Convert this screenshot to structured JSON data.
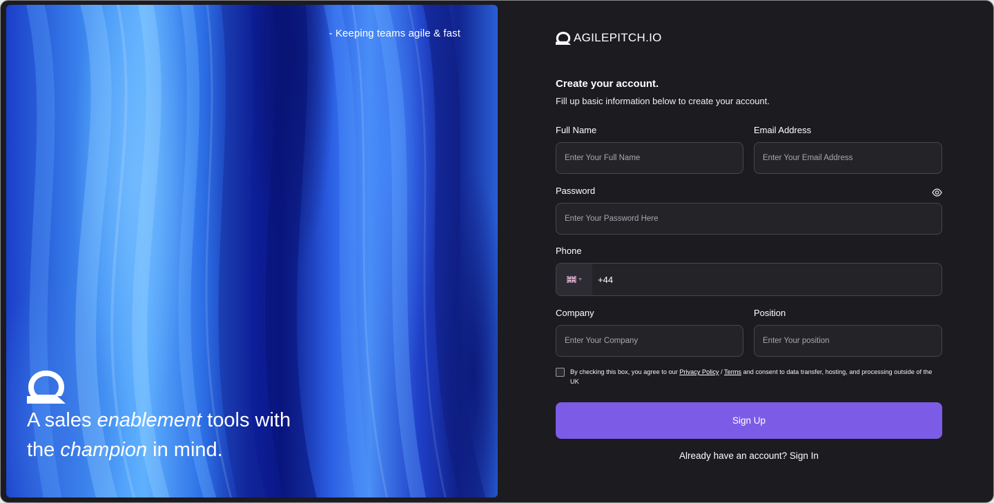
{
  "hero": {
    "quote": "- Keeping teams agile & fast",
    "tagline": {
      "part1": "A sales ",
      "em1": "enablement",
      "part2": " tools with",
      "part3": "the ",
      "em2": "champion",
      "part4": " in mind."
    }
  },
  "brand": {
    "name": "AGILEPITCH.IO"
  },
  "form": {
    "title": "Create your account.",
    "subtitle": "Fill up basic information below to create your account.",
    "full_name": {
      "label": "Full Name",
      "placeholder": "Enter Your Full Name",
      "value": ""
    },
    "email": {
      "label": "Email Address",
      "placeholder": "Enter Your Email Address",
      "value": ""
    },
    "password": {
      "label": "Password",
      "placeholder": "Enter Your Password Here",
      "value": ""
    },
    "phone": {
      "label": "Phone",
      "country": "UK",
      "code": "+44"
    },
    "company": {
      "label": "Company",
      "placeholder": "Enter Your Company",
      "value": ""
    },
    "position": {
      "label": "Position",
      "placeholder": "Enter Your position",
      "value": ""
    },
    "consent": {
      "before": "By checking this box, you agree to our ",
      "privacy": "Privacy Policy",
      "sep": " / ",
      "terms": "Terms",
      "after": " and consent to data transfer, hosting, and processing outside of the UK",
      "checked": false
    },
    "submit_label": "Sign Up",
    "signin_prompt": "Already have an account? ",
    "signin_link": "Sign In"
  },
  "colors": {
    "background": "#1c1b1f",
    "field_bg": "#242328",
    "field_border": "#47464c",
    "accent": "#7c5ce6"
  },
  "icons": [
    "agilepitch-logo-icon",
    "eye-icon",
    "uk-flag-icon",
    "caret-down-icon"
  ]
}
